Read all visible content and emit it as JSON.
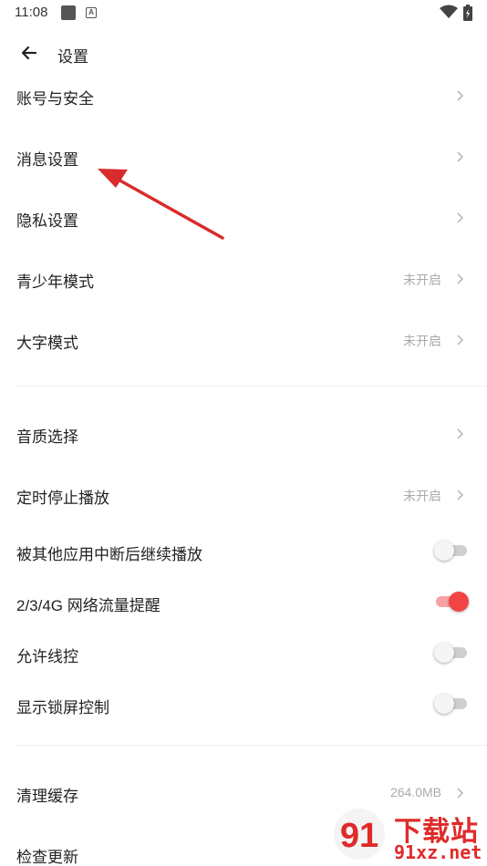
{
  "status_bar": {
    "time": "11:08",
    "badge_letter": "A"
  },
  "header": {
    "title": "设置"
  },
  "group1": [
    {
      "label": "账号与安全",
      "value": ""
    },
    {
      "label": "消息设置",
      "value": ""
    },
    {
      "label": "隐私设置",
      "value": ""
    },
    {
      "label": "青少年模式",
      "value": "未开启"
    },
    {
      "label": "大字模式",
      "value": "未开启"
    }
  ],
  "group2": {
    "nav": [
      {
        "label": "音质选择",
        "value": ""
      },
      {
        "label": "定时停止播放",
        "value": "未开启"
      }
    ],
    "toggles": [
      {
        "label": "被其他应用中断后继续播放",
        "on": false
      },
      {
        "label": "2/3/4G 网络流量提醒",
        "on": true
      },
      {
        "label": "允许线控",
        "on": false
      },
      {
        "label": "显示锁屏控制",
        "on": false
      }
    ]
  },
  "group3": [
    {
      "label": "清理缓存",
      "value": "264.0MB"
    },
    {
      "label": "检查更新",
      "value": ""
    }
  ],
  "annotation": {
    "arrow_color": "#d92b2b"
  },
  "watermark": {
    "line1": "下载站",
    "line2": "91xz.net",
    "logo_text": "91"
  },
  "colors": {
    "accent": "#f24444",
    "secondary_text": "#aaaaaa"
  }
}
